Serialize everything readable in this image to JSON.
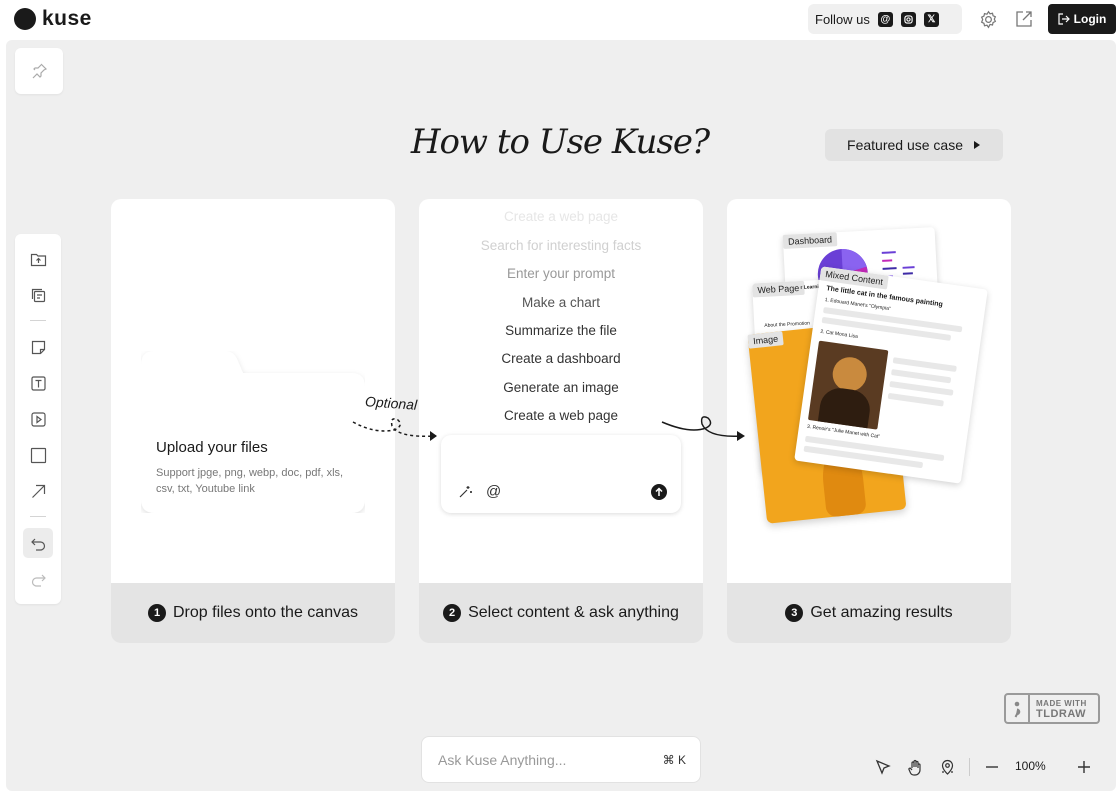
{
  "app": {
    "name": "kuse"
  },
  "topbar": {
    "follow_label": "Follow us",
    "social": [
      "threads-icon",
      "instagram-icon",
      "x-icon"
    ],
    "login_label": "Login"
  },
  "heading": "How to Use Kuse?",
  "featured_label": "Featured use case",
  "cards": [
    {
      "step": "1",
      "footer": "Drop files onto the canvas",
      "upload_title": "Upload your files",
      "upload_sub": "Support jpge, png, webp, doc, pdf, xls, csv, txt, Youtube link"
    },
    {
      "step": "2",
      "footer": "Select content & ask anything",
      "prompts": [
        "Create a web page",
        "Search for interesting facts",
        "Enter your prompt",
        "Make a chart",
        "Summarize the file",
        "Create a dashboard",
        "Generate an image",
        "Create a web page"
      ],
      "mention_symbol": "@"
    },
    {
      "step": "3",
      "footer": "Get amazing results",
      "tags": {
        "dashboard": "Dashboard",
        "web_page": "Web Page",
        "image": "Image",
        "mixed": "Mixed Content"
      },
      "mixed_title": "The little cat in the famous painting",
      "mixed_item1": "1. Edouard Manet's \"Olympia\"",
      "mixed_item2": "2. Cat Mona Lisa",
      "mixed_item3": "3. Renoir's \"Julie Manet with Cat\"",
      "web_heading": "r Learning a",
      "web_sub": "About the Promotion"
    }
  ],
  "optional_label": "Optional",
  "search": {
    "placeholder": "Ask Kuse Anything...",
    "shortcut": "⌘ K"
  },
  "tldraw": {
    "line1": "MADE WITH",
    "line2": "TLDRAW"
  },
  "zoom_level": "100%",
  "colors": {
    "accent": "#1a1a1a",
    "canvas": "#efefef",
    "orange": "#f2a51d",
    "blue": "#2a6fe0"
  }
}
